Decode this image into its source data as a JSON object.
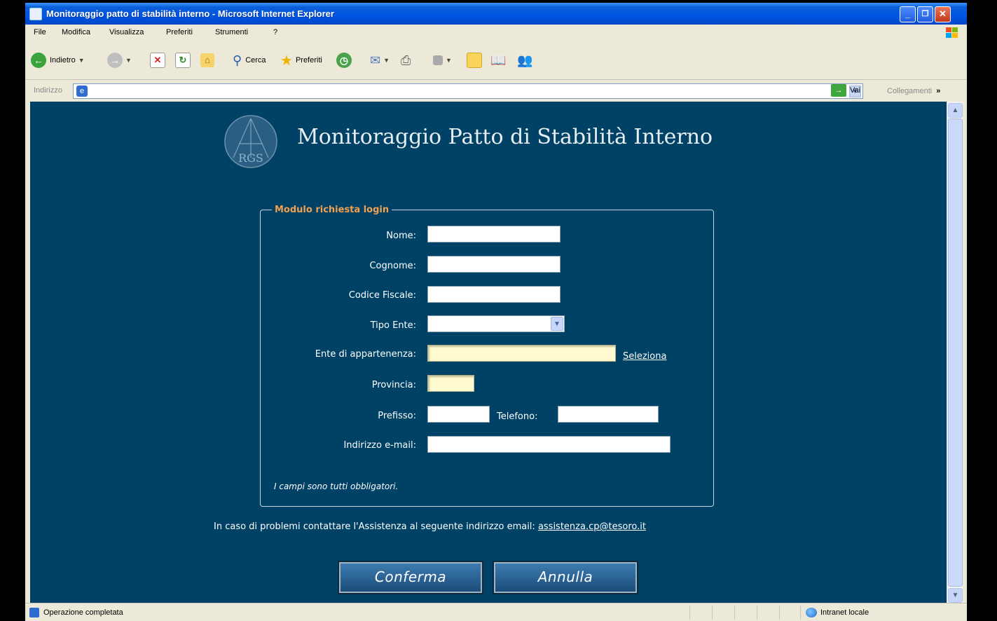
{
  "window": {
    "title": "Monitoraggio patto di stabilità interno - Microsoft Internet Explorer",
    "minimize": "_",
    "maximize": "❐",
    "close": "✕"
  },
  "menu": {
    "items": [
      "File",
      "Modifica",
      "Visualizza",
      "Preferiti",
      "Strumenti",
      "?"
    ]
  },
  "toolbar": {
    "back_label": "Indietro",
    "search_label": "Cerca",
    "favorites_label": "Preferiti"
  },
  "addressbar": {
    "label": "Indirizzo",
    "value": "",
    "go_label": "Vai",
    "links_label": "Collegamenti",
    "links_more": "»"
  },
  "page": {
    "logo_text": "RGS",
    "title": "Monitoraggio Patto di Stabilità Interno",
    "form": {
      "legend": "Modulo richiesta login",
      "fields": {
        "nome": {
          "label": "Nome:",
          "value": ""
        },
        "cognome": {
          "label": "Cognome:",
          "value": ""
        },
        "codice_fiscale": {
          "label": "Codice Fiscale:",
          "value": ""
        },
        "tipo_ente": {
          "label": "Tipo Ente:",
          "value": ""
        },
        "ente": {
          "label": "Ente di appartenenza:",
          "value": "",
          "link": "Seleziona"
        },
        "provincia": {
          "label": "Provincia:",
          "value": ""
        },
        "prefisso": {
          "label": "Prefisso:",
          "value": ""
        },
        "telefono": {
          "label": "Telefono:",
          "value": ""
        },
        "email": {
          "label": "Indirizzo e-mail:",
          "value": ""
        }
      },
      "note": "I campi sono tutti obbligatori."
    },
    "contact_text": "In caso di problemi contattare l'Assistenza al seguente indirizzo email: ",
    "contact_email": "assistenza.cp@tesoro.it",
    "buttons": {
      "confirm": "Conferma",
      "cancel": "Annulla"
    }
  },
  "statusbar": {
    "status": "Operazione completata",
    "zone": "Intranet locale"
  },
  "colors": {
    "page_background": "#004266",
    "legend": "#f0a050",
    "highlight_field": "#fffad0"
  }
}
